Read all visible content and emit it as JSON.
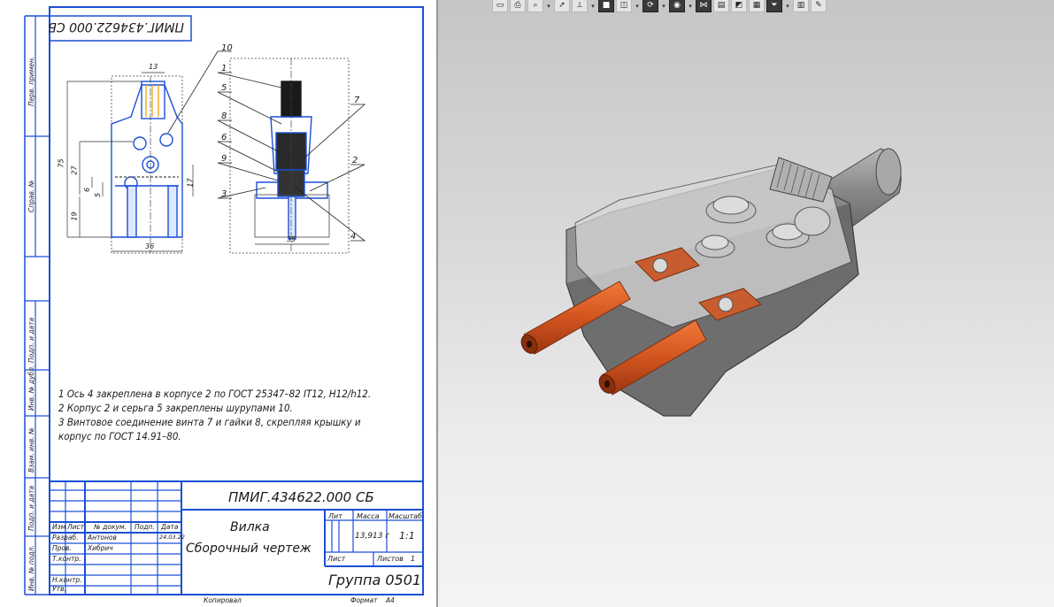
{
  "toolbar": {
    "icons": [
      "sheet-icon",
      "print-icon",
      "zoom-icon",
      "arrow-down",
      "cursor-icon",
      "dimension-icon",
      "arrow-down",
      "box-solid-icon",
      "box-wire-icon",
      "arrow-down",
      "rotate-icon",
      "arrow-down",
      "view-icon",
      "arrow-down",
      "measure-icon",
      "layers-icon",
      "section-icon",
      "properties-icon",
      "filter-icon",
      "arrow-down",
      "grid-icon",
      "pencil-icon"
    ]
  },
  "drawing": {
    "top_stamp": "ПМИГ.434622.000 СБ",
    "side_labels": [
      "Перв. примен.",
      "Справ. №",
      "Подп. и дата",
      "Инв. № дубл.",
      "Взам. инв. №",
      "Подп. и дата",
      "Инв. № подл."
    ],
    "front_dims": {
      "d13": "13",
      "d75": "75",
      "d27": "27",
      "d6": "6",
      "d5": "5",
      "d19": "19",
      "d17": "17",
      "d36": "36"
    },
    "side_dim": "35",
    "callouts": [
      "10",
      "1",
      "5",
      "8",
      "6",
      "9",
      "3",
      "7",
      "2",
      "4"
    ],
    "notes": [
      "1 Ось 4 закреплена в корпусе 2 по ГОСТ 25347–82 IT12, H12/h12.",
      "2 Корпус 2 и серьга 5 закреплены шурупами 10.",
      "3 Винтовое соединение винта 7 и гайки 8, скрепляя крышку и корпус по ГОСТ 14.91–80."
    ],
    "title_block": {
      "designation": "ПМИГ.434622.000 СБ",
      "name_line1": "Вилка",
      "name_line2": "Сборочный чертеж",
      "col_headers": [
        "Изм",
        "Лист",
        "№ докум.",
        "Подп.",
        "Дата"
      ],
      "roles": [
        "Разраб.",
        "Пров.",
        "Т.контр.",
        "",
        "Н.контр.",
        "Утв."
      ],
      "names": [
        "Антонов",
        "Хибрич"
      ],
      "date": "24.03.22",
      "lit_label": "Лит",
      "mass_label": "Масса",
      "scale_label": "Масштаб",
      "mass": "13,913 г",
      "scale": "1:1",
      "sheet_label": "Лист",
      "sheets_label": "Листов",
      "sheets": "1",
      "group": "Группа 0501"
    },
    "footer": {
      "copied": "Копировал",
      "format": "Формат",
      "format_value": "A4"
    }
  },
  "colors": {
    "frame": "#1b4fd6",
    "pins": "#d2541f",
    "body": "#7a7a7a"
  }
}
